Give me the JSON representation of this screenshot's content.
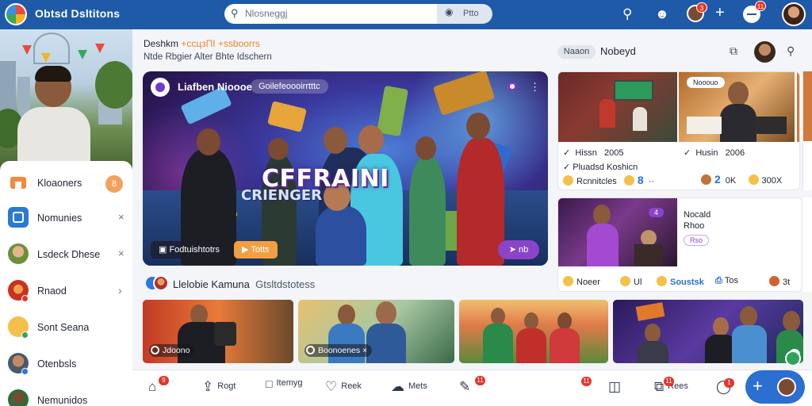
{
  "app": {
    "title": "Obtsd Dsltitons"
  },
  "search": {
    "placeholder": "Nlosneggj",
    "segment_label": "Ptto"
  },
  "topbar": {
    "badge_1": "3",
    "badge_2": "11"
  },
  "main_header": {
    "title_prefix": "Deshkm ",
    "title_highlight": "+ссцзПI +ssboorrs",
    "subtitle": "Ntde Rbgier  Alter  Bhte  Idschern"
  },
  "featured": {
    "channel": "Liafben Nioooe",
    "tag": "Goilefeoooirrtttc",
    "headline": "CFFRAINI",
    "subheadline": "CRIENGER",
    "btn_left": "Fodtuishtotrs",
    "btn_mid": "Totts",
    "btn_right": "nb"
  },
  "right_column": {
    "pill": "Naaon",
    "title": "Nobeyd",
    "card1": {
      "label_a": "Hissn",
      "value_a": "2005",
      "label_b": "Husin",
      "value_b": "2006",
      "line2_a": "Pluadsd Koshicn",
      "line3_a": "Rcnnitcles",
      "num_a": "8",
      "num_b": "2",
      "stat_b": "0K",
      "stat_c": "300X",
      "thumb_tag": "Nooouo"
    },
    "card2": {
      "line1": "Nocald",
      "line2": "Rhoo",
      "tag": "Rso",
      "tag_num": "4",
      "stats": [
        "Noeer",
        "Ul",
        "Soustsk",
        "Tos",
        "3t"
      ]
    }
  },
  "section": {
    "title": "Llelobie Kamuna",
    "title_suffix": "Gtsltdstotess"
  },
  "bottom_thumbs": [
    {
      "label": "Jdoono"
    },
    {
      "label": "Boonoenes"
    }
  ],
  "sidebar": {
    "items": [
      {
        "label": "Kloaoners",
        "pill": "8"
      },
      {
        "label": "Nomunies"
      },
      {
        "label": "Lsdeck Dhese"
      },
      {
        "label": "Rnaod"
      },
      {
        "label": "Sont Seana"
      },
      {
        "label": "Otenbsls"
      },
      {
        "label": "Nemunidos"
      }
    ]
  },
  "bottom_nav": {
    "item1": "",
    "item2": "Rogt",
    "item3": "Itemyg",
    "item4": "Reek",
    "item5": "Mets",
    "badges": [
      "9",
      "11",
      "11",
      "11",
      "1"
    ],
    "item9": "Rees"
  },
  "colors": {
    "brand": "#1f5aa8",
    "accent": "#8b44c9",
    "orange": "#e4892a",
    "fab": "#2a6fd1"
  }
}
